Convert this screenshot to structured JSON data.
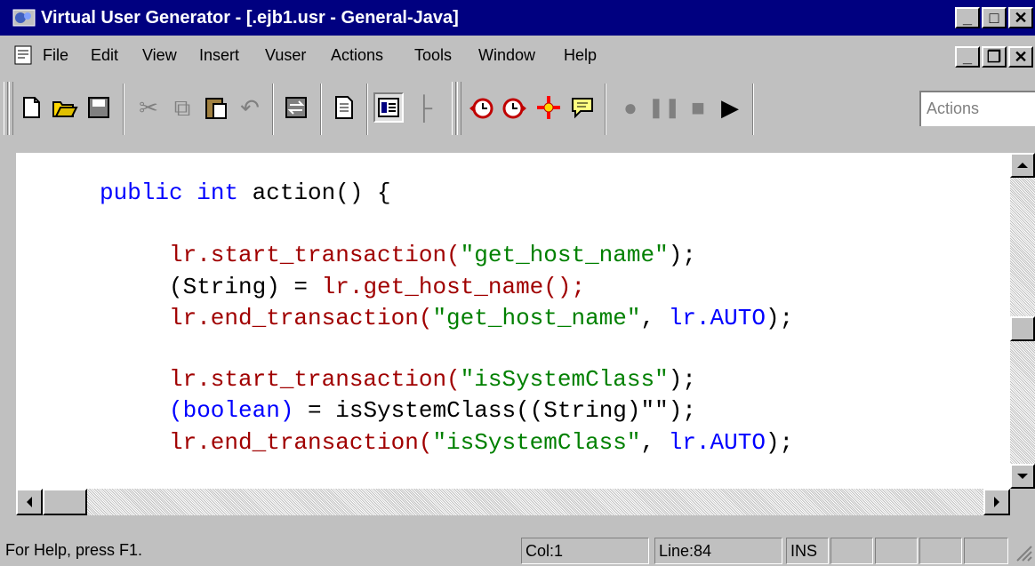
{
  "window": {
    "title": "Virtual User Generator - [.ejb1.usr - General-Java]",
    "minimize": "_",
    "maximize": "□",
    "close": "✕"
  },
  "menubar": {
    "items": [
      {
        "label": "File"
      },
      {
        "label": "Edit"
      },
      {
        "label": "View"
      },
      {
        "label": "Insert"
      },
      {
        "label": "Vuser"
      },
      {
        "label": "Actions"
      },
      {
        "label": "Tools"
      },
      {
        "label": "Window"
      },
      {
        "label": "Help"
      }
    ],
    "doc_min": "_",
    "doc_restore": "❐",
    "doc_close": "✕"
  },
  "toolbar": {
    "buttons": [
      {
        "name": "new-icon",
        "glyph": "🗋"
      },
      {
        "name": "open-icon",
        "glyph": "📂"
      },
      {
        "name": "save-icon",
        "glyph": "💾"
      },
      {
        "name": "cut-icon",
        "glyph": "✂"
      },
      {
        "name": "copy-icon",
        "glyph": "⧉"
      },
      {
        "name": "paste-icon",
        "glyph": "📋"
      },
      {
        "name": "undo-icon",
        "glyph": "↶"
      },
      {
        "name": "compile-icon",
        "glyph": "⇄"
      },
      {
        "name": "script-view-icon",
        "glyph": "📄"
      },
      {
        "name": "tree-view-icon",
        "glyph": "▤"
      },
      {
        "name": "tree-icon",
        "glyph": "├"
      },
      {
        "name": "start-transaction-icon",
        "glyph": "⏱"
      },
      {
        "name": "end-transaction-icon",
        "glyph": "⏲"
      },
      {
        "name": "rendezvous-icon",
        "glyph": "✳"
      },
      {
        "name": "comment-icon",
        "glyph": "💬"
      },
      {
        "name": "record-icon",
        "glyph": "●"
      },
      {
        "name": "pause-icon",
        "glyph": "❚❚"
      },
      {
        "name": "stop-icon",
        "glyph": "■"
      },
      {
        "name": "run-icon",
        "glyph": "▶"
      }
    ],
    "section_combo": "Actions"
  },
  "editor": {
    "lines": [
      {
        "kw1": "public int",
        "rest": " action() {"
      },
      {
        "fn": "lr.start_transaction(",
        "str": "\"get_host_name\"",
        "end": ");"
      },
      {
        "a": "(String) = ",
        "fn": "lr.get_host_name();"
      },
      {
        "fn": "lr.end_transaction(",
        "str": "\"get_host_name\"",
        "mid": ", ",
        "kw": "lr.AUTO",
        "end": ");"
      },
      {
        "fn": "lr.start_transaction(",
        "str": "\"isSystemClass\"",
        "end": ");"
      },
      {
        "kw": "(boolean)",
        "rest": " = isSystemClass((String)\"\");"
      },
      {
        "fn": "lr.end_transaction(",
        "str": "\"isSystemClass\"",
        "mid": ", ",
        "kw": "lr.AUTO",
        "end": ");"
      }
    ]
  },
  "statusbar": {
    "help": "For Help, press F1.",
    "col": "Col:1",
    "line": "Line:84",
    "mode": "INS"
  }
}
